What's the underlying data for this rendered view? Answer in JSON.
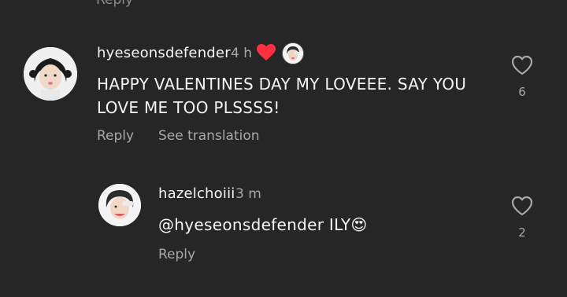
{
  "previous_action": {
    "label": "Reply"
  },
  "comments": [
    {
      "username": "hyeseonsdefender",
      "time": "4 h",
      "text": "HAPPY VALENTINES DAY MY LOVEEE. SAY YOU LOVE ME TOO PLSSSS!",
      "reply_label": "Reply",
      "translate_label": "See translation",
      "like_count": "6",
      "creator_liked": true
    },
    {
      "username": "hazelchoiii",
      "time": "3 m",
      "mention": "@hyeseonsdefender",
      "text": "ILY",
      "emoji": "😍",
      "reply_label": "Reply",
      "like_count": "2"
    }
  ],
  "colors": {
    "background": "#262626",
    "primary_text": "#f5f5f5",
    "secondary_text": "#a8a8a8",
    "heart_red": "#ff3040"
  }
}
